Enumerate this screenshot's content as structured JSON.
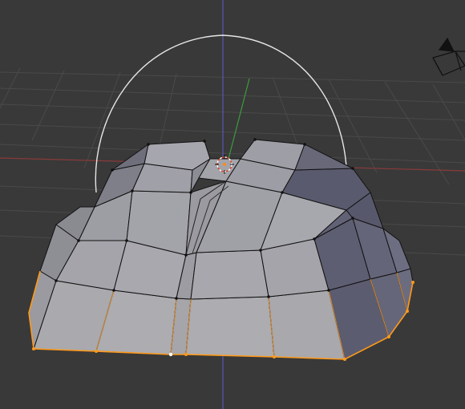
{
  "app": "3D viewport",
  "colors": {
    "background": "#393939",
    "grid": "#4a4a4a",
    "axis_x": "#8a3a3a",
    "axis_y": "#3f9a3f",
    "axis_z": "#5a5ab0",
    "selection": "#ff9a1a",
    "face_light": "#a8a8ae",
    "face_dark": "#5f5f74",
    "edge": "#111111",
    "manipulator_circle": "#e6e6e6",
    "cursor_red": "#e04020",
    "cursor_white": "#ffffff"
  },
  "icons": {
    "camera": "camera-icon",
    "cursor": "3d-cursor-icon"
  }
}
